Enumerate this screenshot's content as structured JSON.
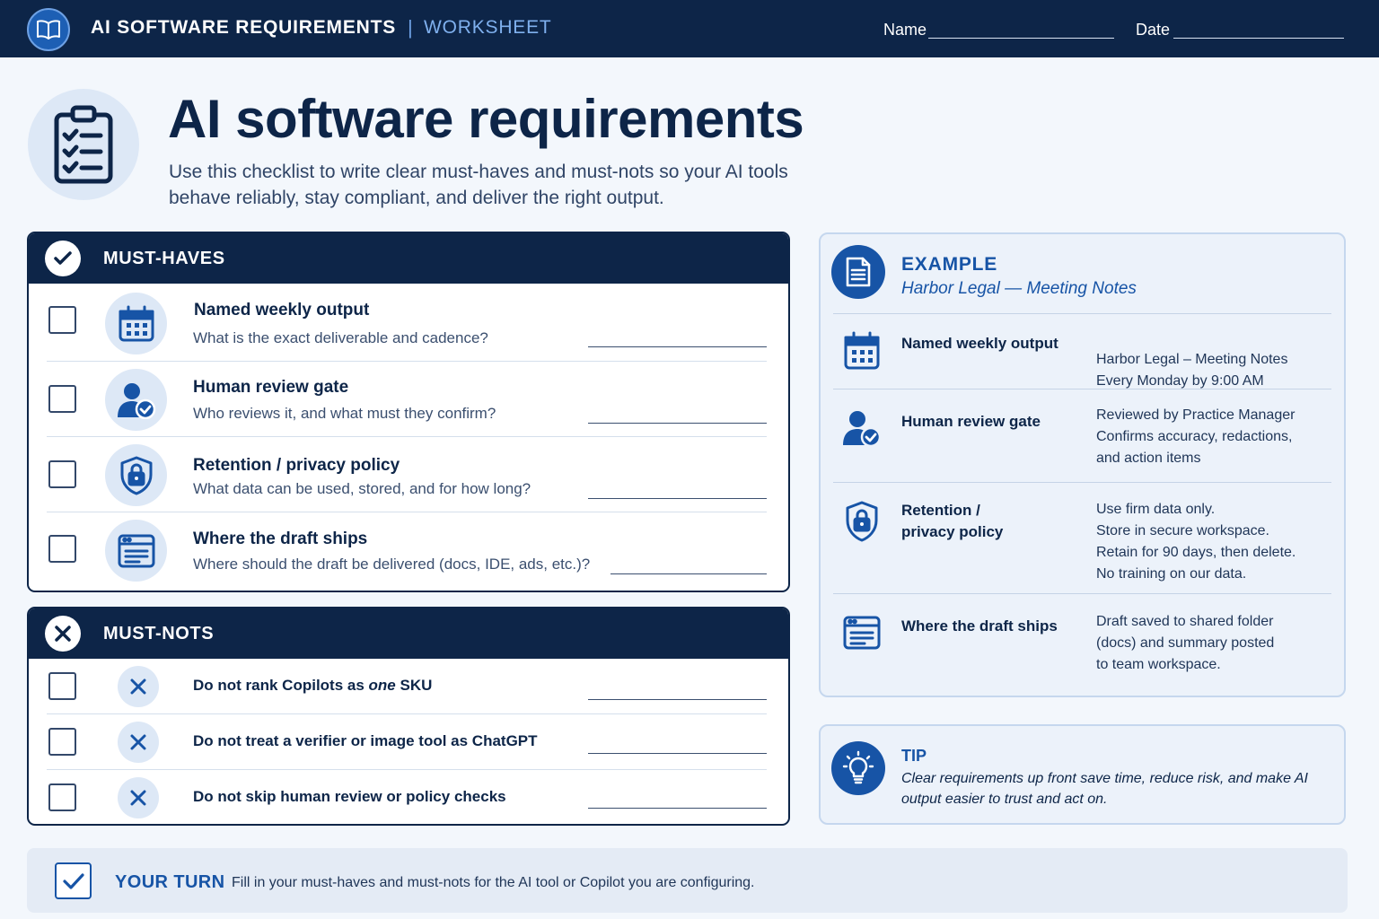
{
  "header": {
    "title": "AI SOFTWARE REQUIREMENTS",
    "separator": "|",
    "subtitle": "WORKSHEET",
    "name_label": "Name",
    "date_label": "Date"
  },
  "hero": {
    "title": "AI software requirements",
    "subtitle": "Use this checklist to write clear must-haves and must-nots so your AI tools behave reliably, stay compliant, and deliver the right output."
  },
  "must_haves": {
    "heading": "MUST-HAVES",
    "items": [
      {
        "title": "Named weekly output",
        "question": "What is the exact deliverable and cadence?",
        "icon": "calendar-icon"
      },
      {
        "title": "Human review gate",
        "question": "Who reviews it, and what must they confirm?",
        "icon": "user-check-icon"
      },
      {
        "title": "Retention / privacy policy",
        "question": "What data can be used, stored, and for how long?",
        "icon": "shield-lock-icon"
      },
      {
        "title": "Where the draft ships",
        "question": "Where should the draft be delivered (docs, IDE, ads, etc.)?",
        "icon": "browser-window-icon"
      }
    ]
  },
  "must_nots": {
    "heading": "MUST-NOTS",
    "items": [
      {
        "before": "Do not rank Copilots as ",
        "emphasis": "one",
        "after": " SKU"
      },
      {
        "before": "Do not treat a verifier or image tool as ChatGPT",
        "emphasis": "",
        "after": ""
      },
      {
        "before": "Do not skip human review or policy checks",
        "emphasis": "",
        "after": ""
      }
    ]
  },
  "example": {
    "heading": "EXAMPLE",
    "subheading": "Harbor Legal — Meeting Notes",
    "rows": [
      {
        "label": "Named weekly output",
        "value": "Harbor Legal – Meeting Notes\nEvery Monday by 9:00 AM",
        "icon": "calendar-icon"
      },
      {
        "label": "Human review gate",
        "value": "Reviewed by Practice Manager\nConfirms accuracy, redactions,\nand action items",
        "icon": "user-check-icon"
      },
      {
        "label": "Retention /\nprivacy policy",
        "value": "Use firm data only.\nStore in secure workspace.\nRetain for 90 days, then delete.\nNo training on our data.",
        "icon": "shield-lock-icon"
      },
      {
        "label": "Where the draft ships",
        "value": "Draft saved to shared folder\n(docs) and summary posted\nto team workspace.",
        "icon": "browser-window-icon"
      }
    ]
  },
  "tip": {
    "heading": "TIP",
    "body": "Clear requirements up front save time, reduce risk, and make AI output easier to trust and act on."
  },
  "your_turn": {
    "heading": "YOUR TURN",
    "body": "Fill in your must-haves and must-nots for the AI tool or Copilot you are configuring."
  },
  "colors": {
    "navy": "#0d2548",
    "accent": "#1754a6",
    "light_blue": "#dde8f6",
    "page_bg": "#f3f7fc"
  }
}
